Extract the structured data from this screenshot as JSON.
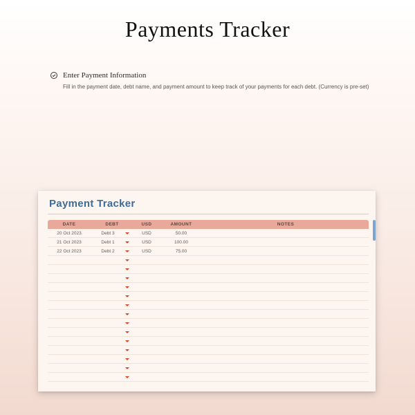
{
  "page": {
    "title": "Payments Tracker",
    "instruction_heading": "Enter Payment Information",
    "instruction_body": "Fill in the payment date, debt name, and payment amount to keep track of your payments for each debt. (Currency is pre-set)"
  },
  "sheet": {
    "title": "Payment Tracker",
    "columns": {
      "date": "DATE",
      "debt": "DEBT",
      "usd": "USD",
      "amount": "AMOUNT",
      "notes": "NOTES"
    },
    "rows": [
      {
        "date": "20 Oct 2023",
        "debt": "Debt 3",
        "usd": "USD",
        "amount": "50.00",
        "notes": ""
      },
      {
        "date": "21 Oct 2023",
        "debt": "Debt 1",
        "usd": "USD",
        "amount": "100.00",
        "notes": ""
      },
      {
        "date": "22 Oct 2023",
        "debt": "Debt 2",
        "usd": "USD",
        "amount": "75.00",
        "notes": ""
      }
    ],
    "empty_row_count": 14
  }
}
